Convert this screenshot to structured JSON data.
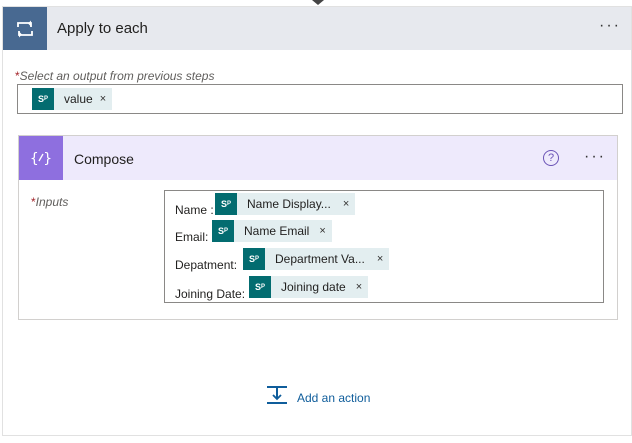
{
  "apply_to_each": {
    "title": "Apply to each",
    "more_label": "···"
  },
  "select_output": {
    "required_mark": "*",
    "label": "Select an output from previous steps",
    "token": {
      "icon": "sharepoint-icon",
      "text": "value",
      "remove": "×"
    }
  },
  "compose": {
    "title": "Compose",
    "icon_text": "{⁄}",
    "help_label": "?",
    "more_label": "···",
    "inputs_required_mark": "*",
    "inputs_label": "Inputs",
    "lines": [
      {
        "label": "Name :",
        "token": "Name Display...",
        "remove": "×"
      },
      {
        "label": "Email:",
        "token": "Name Email",
        "remove": "×"
      },
      {
        "label": "Depatment:",
        "token": "Department Va...",
        "remove": "×"
      },
      {
        "label": "Joining Date:",
        "token": "Joining date",
        "remove": "×"
      }
    ]
  },
  "add_action": {
    "label": "Add an action"
  },
  "colors": {
    "apply_header_bg": "#e7e9ee",
    "apply_icon_bg": "#486991",
    "compose_header_bg": "#eeeafc",
    "compose_icon_bg": "#8e6fdf",
    "sharepoint": "#036c70",
    "token_bg": "#e3eef0",
    "link": "#0f5d9b"
  }
}
